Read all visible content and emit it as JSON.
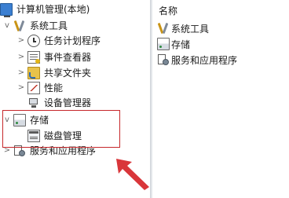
{
  "tree": {
    "root": {
      "label": "计算机管理(本地)",
      "icon": "computer-management-icon"
    },
    "system_tools": {
      "label": "系统工具",
      "icon": "tools-icon",
      "expander": "v"
    },
    "task_scheduler": {
      "label": "任务计划程序",
      "icon": "clock-icon",
      "expander": ">"
    },
    "event_viewer": {
      "label": "事件查看器",
      "icon": "event-viewer-icon",
      "expander": ">"
    },
    "shared_folders": {
      "label": "共享文件夹",
      "icon": "shared-folder-icon",
      "expander": ">"
    },
    "performance": {
      "label": "性能",
      "icon": "performance-icon",
      "expander": ">"
    },
    "device_manager": {
      "label": "设备管理器",
      "icon": "device-manager-icon"
    },
    "storage": {
      "label": "存储",
      "icon": "storage-icon",
      "expander": "v"
    },
    "disk_management": {
      "label": "磁盘管理",
      "icon": "disk-icon"
    },
    "services_apps": {
      "label": "服务和应用程序",
      "icon": "services-icon",
      "expander": ">"
    }
  },
  "right_pane": {
    "column_header": "名称",
    "items": [
      {
        "label": "系统工具",
        "icon": "tools-icon"
      },
      {
        "label": "存储",
        "icon": "storage-icon"
      },
      {
        "label": "服务和应用程序",
        "icon": "services-icon"
      }
    ]
  },
  "annotation": {
    "highlight_color": "#c6282b",
    "arrow_color": "#d9363a"
  }
}
